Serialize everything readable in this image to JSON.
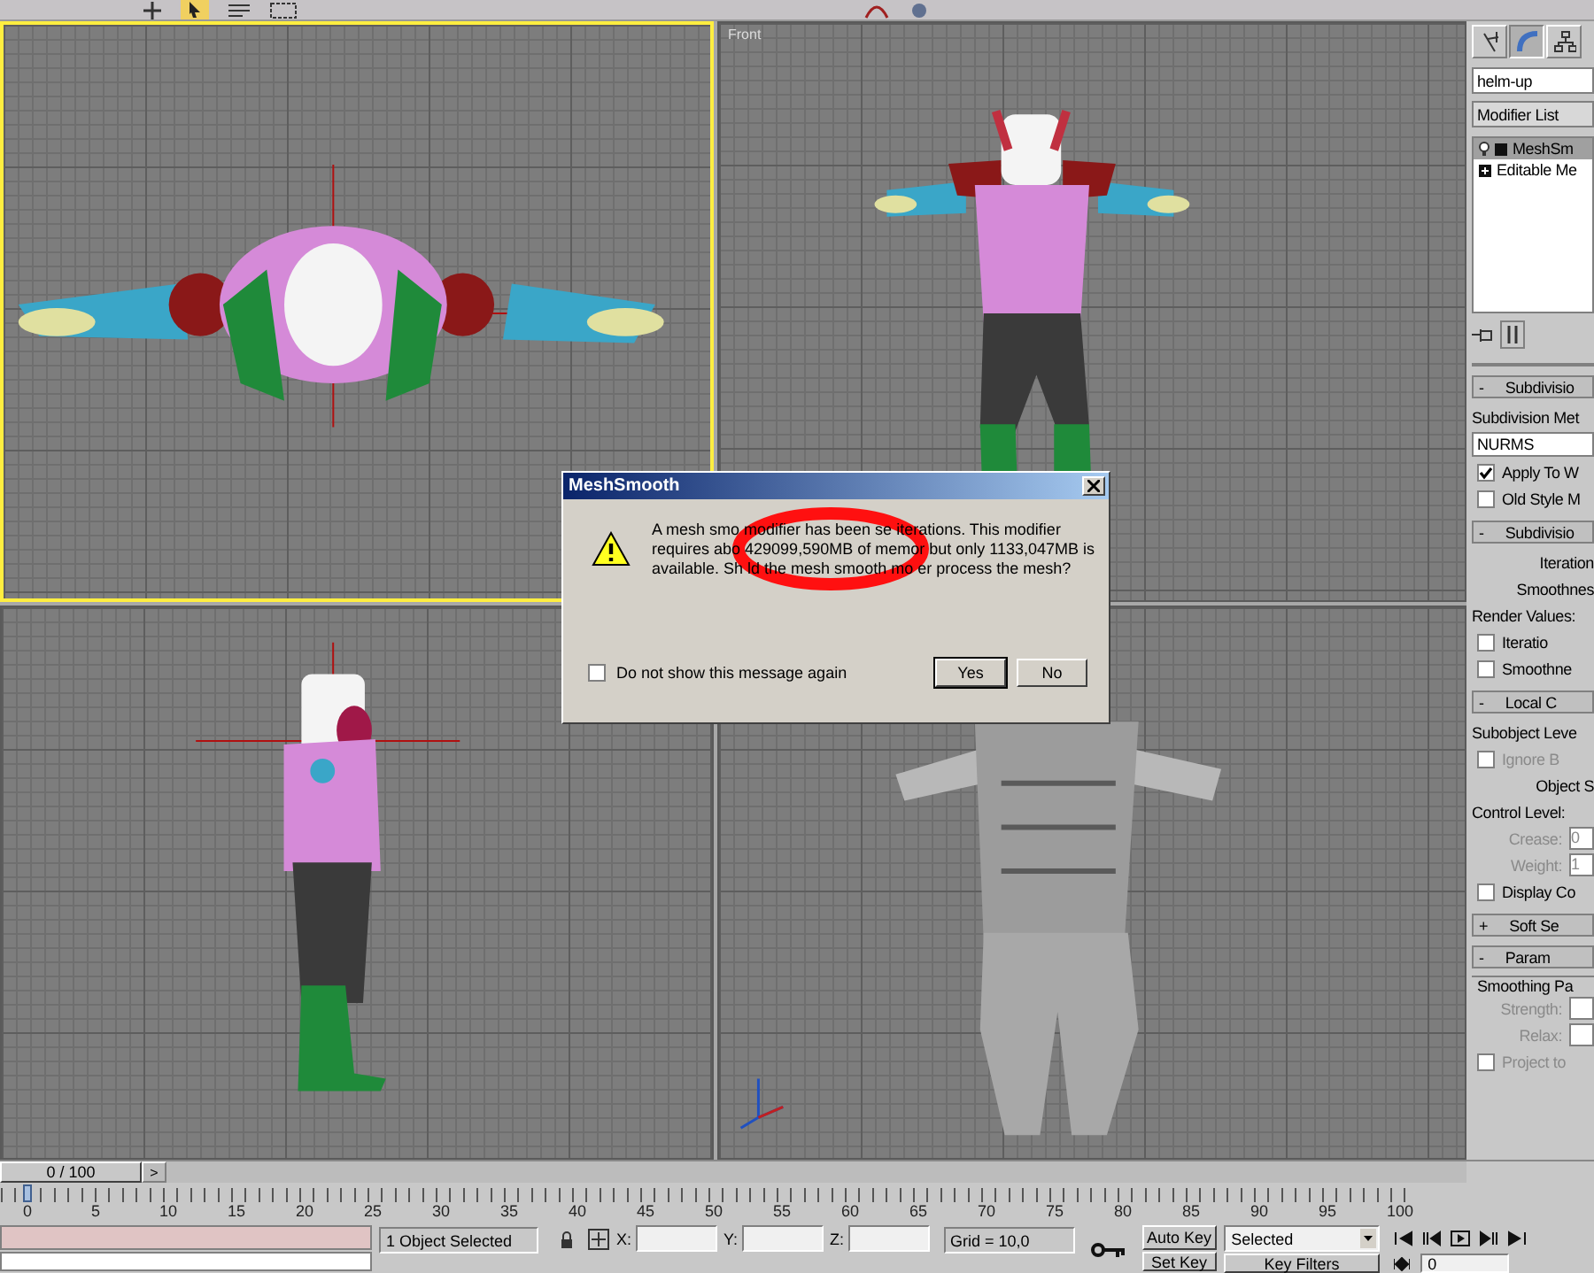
{
  "viewports": [
    {
      "kind": "top",
      "active": true
    },
    {
      "kind": "front",
      "label": "Front",
      "active": false
    },
    {
      "kind": "left",
      "active": false
    },
    {
      "kind": "perspective",
      "active": false
    }
  ],
  "dialog": {
    "title": "MeshSmooth",
    "message_lines": [
      "A mesh smo modifier has been se iterations. This modifier",
      "requires abo 429099,590MB of memor but only 1133,047MB is",
      "available. Sh ld the mesh smooth mo er process the mesh?"
    ],
    "checkbox": {
      "label": "Do not show this message again",
      "checked": false
    },
    "buttons": [
      {
        "label": "Yes",
        "default": true
      },
      {
        "label": "No",
        "default": false
      }
    ]
  },
  "command_panel": {
    "tabs": [
      {
        "kind": "create",
        "selected": false
      },
      {
        "kind": "modify",
        "selected": true
      },
      {
        "kind": "hierarchy",
        "selected": false
      }
    ],
    "object_name": "helm-up",
    "modifier_list": "Modifier List",
    "stack": [
      {
        "label": "MeshSm",
        "selected": true,
        "expandable": false
      },
      {
        "label": "Editable Me",
        "selected": false,
        "expandable": true
      }
    ],
    "rollouts": [
      {
        "sign": "-",
        "title": "Subdivisio",
        "items": [
          {
            "kind": "label",
            "text": "Subdivision Met"
          },
          {
            "kind": "dropdown",
            "text": "NURMS"
          },
          {
            "kind": "checkbox",
            "text": "Apply To W",
            "checked": true,
            "disabled": false
          },
          {
            "kind": "checkbox",
            "text": "Old Style M",
            "checked": false,
            "disabled": false
          }
        ]
      },
      {
        "sign": "-",
        "title": "Subdivisio",
        "items": [
          {
            "kind": "right",
            "text": "Iteration"
          },
          {
            "kind": "right",
            "text": "Smoothnes"
          },
          {
            "kind": "label",
            "text": "Render Values:"
          },
          {
            "kind": "checkbox",
            "text": "Iteratio",
            "checked": false,
            "disabled": false
          },
          {
            "kind": "checkbox",
            "text": "Smoothne",
            "checked": false,
            "disabled": false
          }
        ]
      },
      {
        "sign": "-",
        "title": "Local C",
        "items": [
          {
            "kind": "label",
            "text": "Subobject Leve"
          },
          {
            "kind": "checkbox",
            "text": "Ignore B",
            "checked": false,
            "disabled": true
          },
          {
            "kind": "right",
            "text": "Object S"
          },
          {
            "kind": "label",
            "text": "Control Level:"
          },
          {
            "kind": "spinner",
            "text": "Crease:",
            "value": "0",
            "disabled": true
          },
          {
            "kind": "spinner",
            "text": "Weight:",
            "value": "1",
            "disabled": true
          },
          {
            "kind": "checkbox",
            "text": "Display Co",
            "checked": false,
            "disabled": false
          }
        ]
      },
      {
        "sign": "+",
        "title": "Soft Se"
      },
      {
        "sign": "-",
        "title": "Param",
        "items": [
          {
            "kind": "group",
            "text": "Smoothing Pa"
          },
          {
            "kind": "spinner",
            "text": "Strength:",
            "disabled": true
          },
          {
            "kind": "spinner",
            "text": "Relax:",
            "disabled": true
          },
          {
            "kind": "checkbox",
            "text": "Project to",
            "checked": false,
            "disabled": true
          }
        ]
      }
    ]
  },
  "time_slider": {
    "label": "0 / 100",
    "next": ">",
    "level": 0
  },
  "ruler": {
    "ticks": [
      "0",
      "5",
      "10",
      "15",
      "20",
      "25",
      "30",
      "35",
      "40",
      "45",
      "50",
      "55",
      "60",
      "65",
      "70",
      "75",
      "80",
      "85",
      "90",
      "95",
      "100"
    ]
  },
  "status_bar": {
    "selection": "1 Object Selected",
    "x_label": "X:",
    "y_label": "Y:",
    "z_label": "Z:",
    "grid": "Grid = 10,0",
    "auto_key": "Auto Key",
    "set_key": "Set Key",
    "key_mode": "Selected",
    "key_filters": "Key Filters",
    "frame": "0"
  }
}
